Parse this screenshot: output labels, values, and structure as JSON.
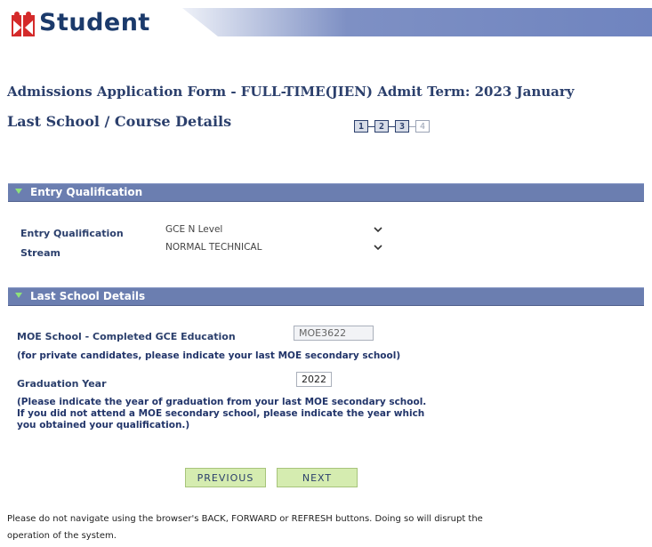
{
  "header": {
    "logo_text": "Student"
  },
  "form_title": "Admissions Application Form - FULL-TIME(JIEN)   Admit Term: 2023 January",
  "page_heading": "Last School / Course Details",
  "steps": [
    {
      "label": "1",
      "state": "done"
    },
    {
      "label": "2",
      "state": "current"
    },
    {
      "label": "3",
      "state": "done"
    },
    {
      "label": "4",
      "state": "inactive"
    }
  ],
  "entry_section": {
    "title": "Entry Qualification",
    "qualification_label": "Entry Qualification",
    "qualification_value": "GCE N Level",
    "stream_label": "Stream",
    "stream_value": "NORMAL TECHNICAL"
  },
  "school_section": {
    "title": "Last School Details",
    "moe_label": "MOE School - Completed GCE Education",
    "moe_value": "MOE3622",
    "moe_note": "(for private candidates, please indicate your last MOE secondary school)",
    "grad_label": "Graduation Year",
    "grad_value": "2022",
    "grad_note_1": "(Please indicate the year of graduation from your last MOE secondary school.",
    "grad_note_2": "If you did not attend a MOE secondary school, please indicate the year which",
    "grad_note_3": "you obtained your qualification.)"
  },
  "buttons": {
    "previous": "PREVIOUS",
    "next": "NEXT"
  },
  "footer": {
    "line1": "Please do not navigate using the browser's BACK, FORWARD or REFRESH buttons. Doing so will disrupt the",
    "line2": "operation of the system."
  },
  "colors": {
    "brand": "#1b3a6b",
    "logo_red": "#d42a2a",
    "section_bar": "#6b7eb0",
    "button": "#d5ecb0"
  }
}
